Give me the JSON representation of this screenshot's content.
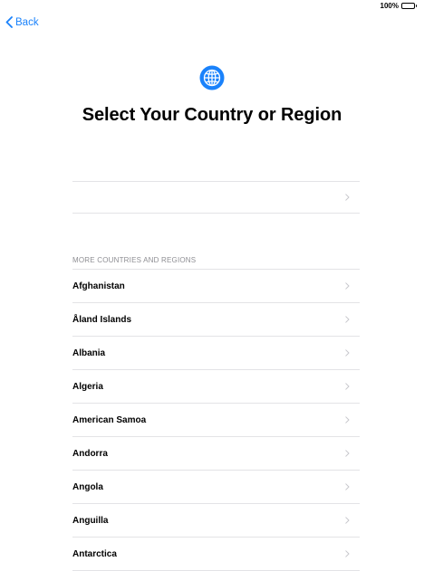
{
  "status_bar": {
    "battery_percent": "100%",
    "battery_icon": "battery-full-icon"
  },
  "nav": {
    "back_label": "Back",
    "back_icon": "chevron-left-icon"
  },
  "header": {
    "icon": "globe-icon",
    "title": "Select Your Country or Region"
  },
  "suggested": {
    "label": ""
  },
  "list": {
    "section_header": "MORE COUNTRIES AND REGIONS",
    "items": [
      {
        "label": "Afghanistan"
      },
      {
        "label": "Åland Islands"
      },
      {
        "label": "Albania"
      },
      {
        "label": "Algeria"
      },
      {
        "label": "American Samoa"
      },
      {
        "label": "Andorra"
      },
      {
        "label": "Angola"
      },
      {
        "label": "Anguilla"
      },
      {
        "label": "Antarctica"
      }
    ]
  },
  "colors": {
    "accent": "#1a82fb",
    "separator": "#e3e3e6",
    "section_header": "#8e8e93",
    "chevron": "#c7c7cc"
  }
}
